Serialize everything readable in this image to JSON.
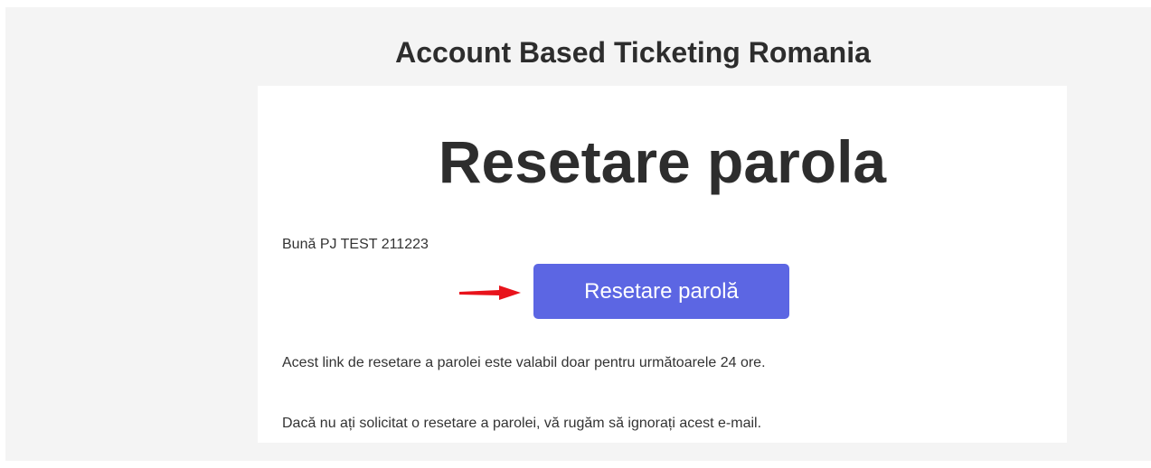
{
  "header": {
    "brand_title": "Account Based Ticketing Romania"
  },
  "card": {
    "title": "Resetare parola",
    "greeting": "Bună PJ TEST 211223",
    "button_label": "Resetare parolă",
    "validity_text": "Acest link de resetare a parolei este valabil doar pentru următoarele 24 ore.",
    "ignore_text": "Dacă nu ați solicitat o resetare a parolei, vă rugăm să ignorați acest e-mail."
  },
  "annotation": {
    "icon": "red-arrow-right-icon",
    "color": "#e8131b"
  },
  "colors": {
    "button": "#5c66e3",
    "background": "#f4f4f4",
    "card": "#ffffff",
    "text": "#333333"
  }
}
